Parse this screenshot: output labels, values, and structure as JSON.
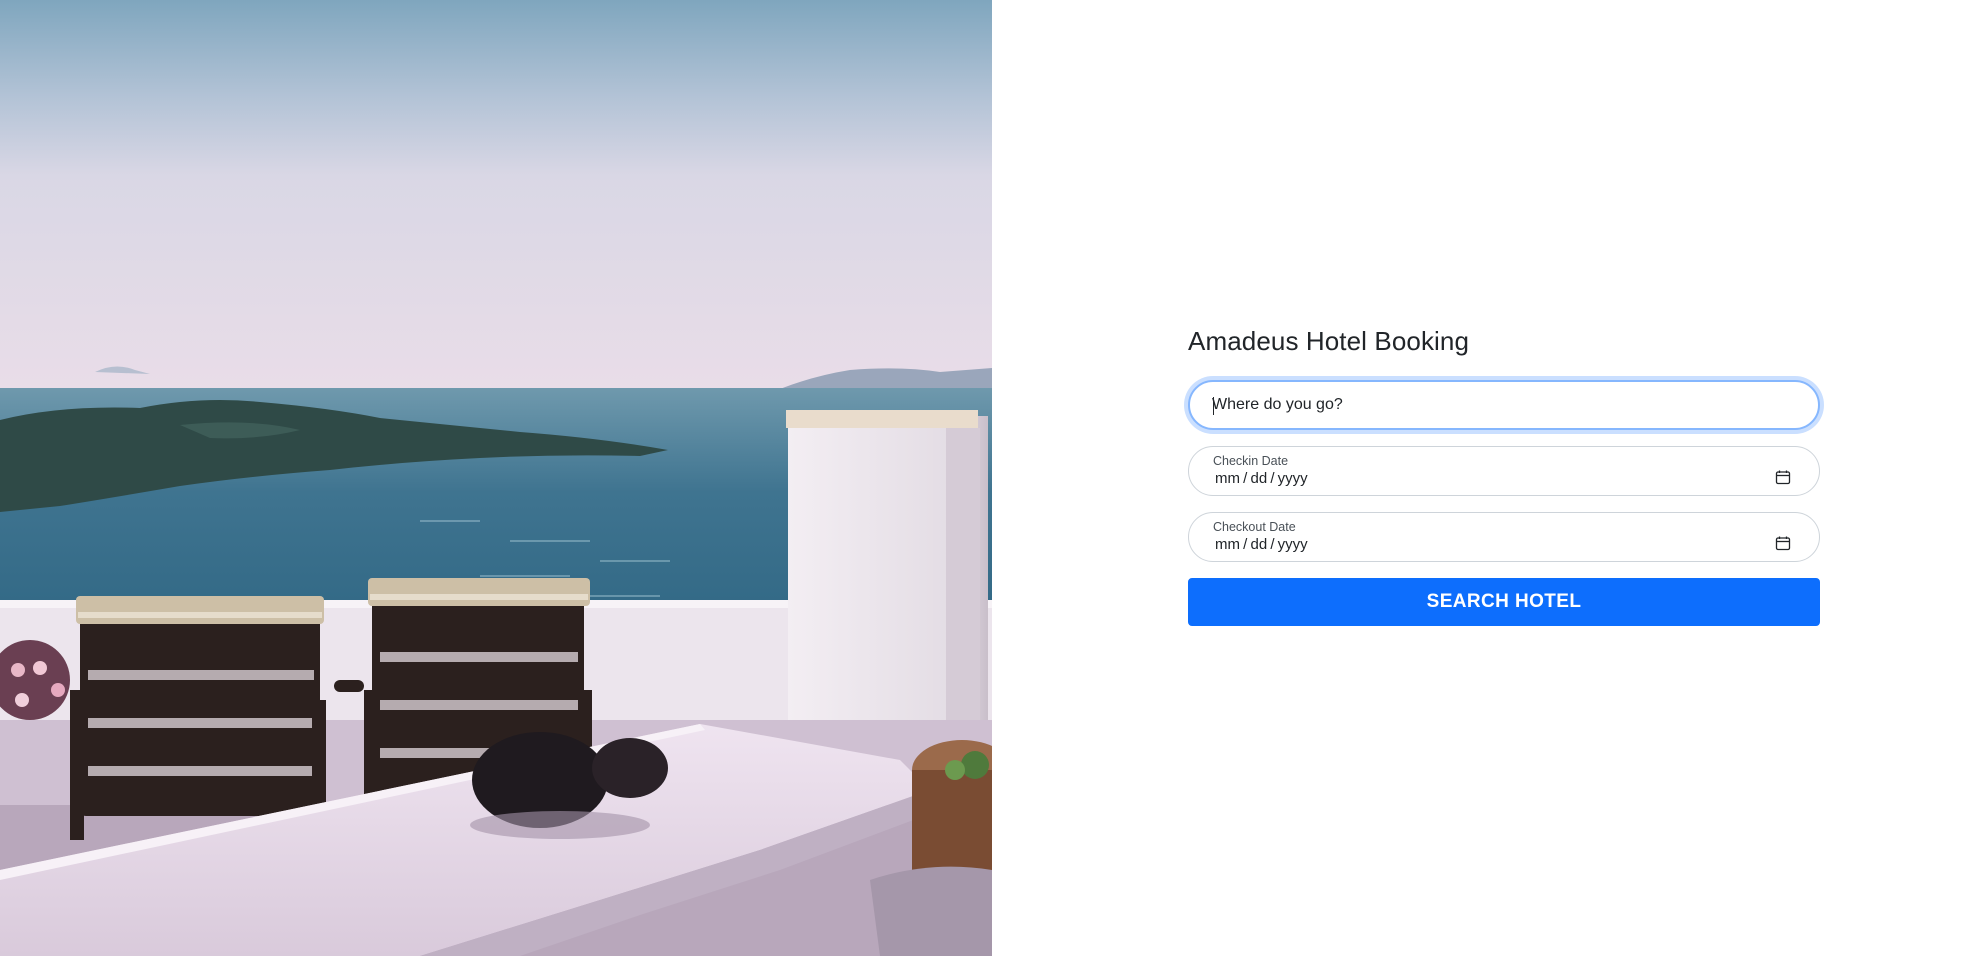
{
  "app": {
    "title": "Amadeus Hotel Booking"
  },
  "hero": {
    "icon": "hero-image"
  },
  "form": {
    "destination": {
      "placeholder": "Where do you go?",
      "value": ""
    },
    "checkin": {
      "label": "Checkin Date",
      "value": "mm / dd / yyyy",
      "icon": "calendar-icon"
    },
    "checkout": {
      "label": "Checkout Date",
      "value": "mm / dd / yyyy",
      "icon": "calendar-icon"
    },
    "submit_label": "SEARCH HOTEL"
  },
  "colors": {
    "primary": "#0d6efd",
    "focus_ring": "#86b7fe",
    "border": "#ced4da",
    "text": "#212529"
  }
}
